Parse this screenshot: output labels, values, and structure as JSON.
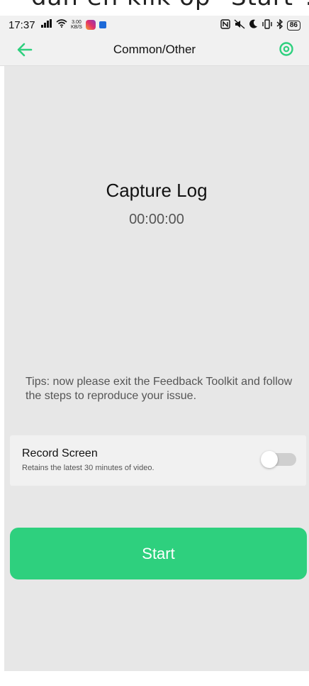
{
  "caption": {
    "text": "dan en klik op \"Start\"."
  },
  "statusbar": {
    "time": "17:37",
    "netspeed_value": "3.00",
    "netspeed_unit": "KB/S",
    "battery": "86"
  },
  "header": {
    "title": "Common/Other",
    "accent_color": "#2ed07e"
  },
  "capture": {
    "title": "Capture Log",
    "timer": "00:00:00"
  },
  "tips": {
    "text": "Tips: now please exit the Feedback Toolkit and follow the steps to reproduce your issue."
  },
  "record": {
    "title": "Record Screen",
    "subtitle": "Retains the latest 30 minutes of video.",
    "enabled": false
  },
  "actions": {
    "start_label": "Start",
    "start_color": "#2ed07e"
  }
}
